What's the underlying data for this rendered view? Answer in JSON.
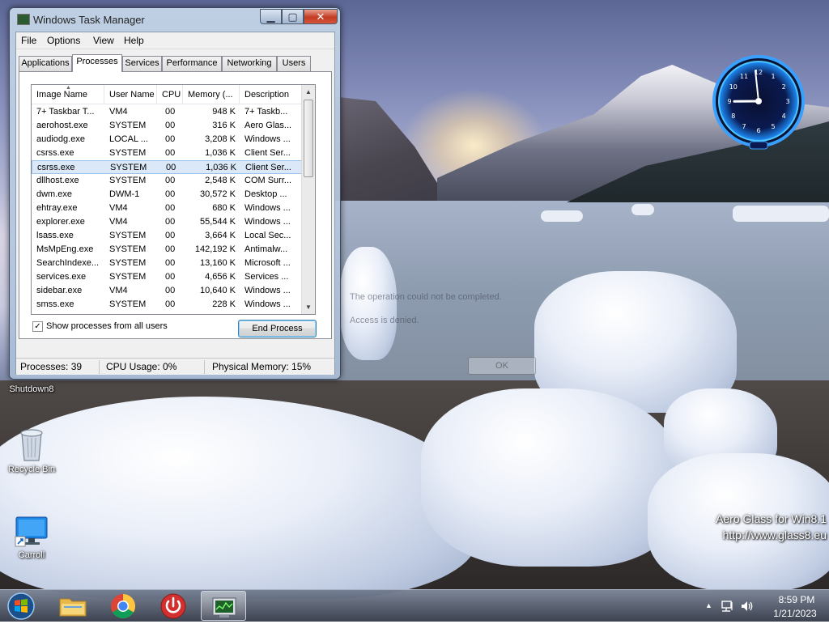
{
  "task_manager": {
    "title": "Windows Task Manager",
    "caption_buttons": {
      "minimize": "▁",
      "maximize": "▢",
      "close": "✕"
    },
    "menu": [
      "File",
      "Options",
      "View",
      "Help"
    ],
    "tabs": [
      "Applications",
      "Processes",
      "Services",
      "Performance",
      "Networking",
      "Users"
    ],
    "active_tab": "Processes",
    "columns": [
      "Image Name",
      "User Name",
      "CPU",
      "Memory (...",
      "Description"
    ],
    "processes": [
      {
        "name": "7+ Taskbar T...",
        "user": "VM4",
        "cpu": "00",
        "memory": "948 K",
        "description": "7+ Taskb..."
      },
      {
        "name": "aerohost.exe",
        "user": "SYSTEM",
        "cpu": "00",
        "memory": "316 K",
        "description": "Aero Glas..."
      },
      {
        "name": "audiodg.exe",
        "user": "LOCAL ...",
        "cpu": "00",
        "memory": "3,208 K",
        "description": "Windows ..."
      },
      {
        "name": "csrss.exe",
        "user": "SYSTEM",
        "cpu": "00",
        "memory": "1,036 K",
        "description": "Client Ser..."
      },
      {
        "name": "csrss.exe",
        "user": "SYSTEM",
        "cpu": "00",
        "memory": "1,036 K",
        "description": "Client Ser...",
        "selected": true
      },
      {
        "name": "dllhost.exe",
        "user": "SYSTEM",
        "cpu": "00",
        "memory": "2,548 K",
        "description": "COM Surr..."
      },
      {
        "name": "dwm.exe",
        "user": "DWM-1",
        "cpu": "00",
        "memory": "30,572 K",
        "description": "Desktop ..."
      },
      {
        "name": "ehtray.exe",
        "user": "VM4",
        "cpu": "00",
        "memory": "680 K",
        "description": "Windows ..."
      },
      {
        "name": "explorer.exe",
        "user": "VM4",
        "cpu": "00",
        "memory": "55,544 K",
        "description": "Windows ..."
      },
      {
        "name": "lsass.exe",
        "user": "SYSTEM",
        "cpu": "00",
        "memory": "3,664 K",
        "description": "Local Sec..."
      },
      {
        "name": "MsMpEng.exe",
        "user": "SYSTEM",
        "cpu": "00",
        "memory": "142,192 K",
        "description": "Antimalw..."
      },
      {
        "name": "SearchIndexe...",
        "user": "SYSTEM",
        "cpu": "00",
        "memory": "13,160 K",
        "description": "Microsoft ..."
      },
      {
        "name": "services.exe",
        "user": "SYSTEM",
        "cpu": "00",
        "memory": "4,656 K",
        "description": "Services ..."
      },
      {
        "name": "sidebar.exe",
        "user": "VM4",
        "cpu": "00",
        "memory": "10,640 K",
        "description": "Windows ..."
      },
      {
        "name": "smss.exe",
        "user": "SYSTEM",
        "cpu": "00",
        "memory": "228 K",
        "description": "Windows ..."
      }
    ],
    "show_all_label": "Show processes from all users",
    "show_all_checked": true,
    "check_mark": "✓",
    "end_process_label": "End Process",
    "status": {
      "processes": "Processes: 39",
      "cpu_usage": "CPU Usage: 0%",
      "physical_memory": "Physical Memory: 15%"
    }
  },
  "ghost_dialog": {
    "message": "The operation could not be completed.",
    "detail": "Access is denied.",
    "ok_label": "OK"
  },
  "desktop_icons": [
    {
      "label": "Shutdown8",
      "icon": "shutdown-shortcut-icon"
    },
    {
      "label": "Recycle Bin",
      "icon": "recycle-bin-icon"
    },
    {
      "label": "Carroll",
      "icon": "computer-shortcut-icon"
    }
  ],
  "watermark": {
    "line1": "Aero Glass for Win8.1",
    "line2": "http://www.glass8.eu"
  },
  "clock_gadget": {
    "numerals": [
      "12",
      "1",
      "2",
      "3",
      "4",
      "5",
      "6",
      "7",
      "8",
      "9",
      "10",
      "11"
    ],
    "hour": 8,
    "minute": 59
  },
  "taskbar": {
    "pinned": [
      "windows-start-orb",
      "file-explorer-icon",
      "chrome-icon",
      "shutdown-app-icon",
      "task-manager-icon"
    ],
    "tray": {
      "show_hidden": "▲",
      "time": "8:59 PM",
      "date": "1/21/2023"
    }
  },
  "colors": {
    "selection": "#dbe8f7",
    "close_button": "#c23b22",
    "clock_glow": "#1e90ff"
  }
}
